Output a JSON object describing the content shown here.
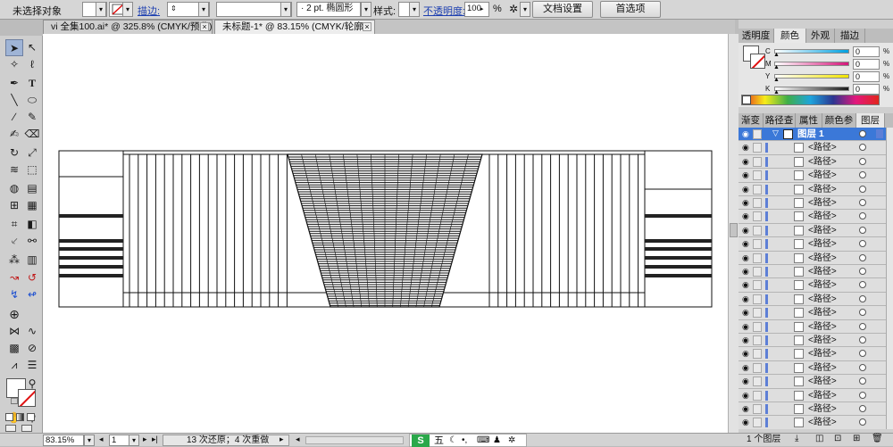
{
  "control_bar": {
    "selection_status": "未选择对象",
    "stroke_label": "描边:",
    "brush_value": "2 pt. 椭圆形",
    "style_label": "样式:",
    "opacity_label": "不透明度:",
    "opacity_value": "100",
    "opacity_unit": "%",
    "doc_setup_button": "文档设置",
    "preferences_button": "首选项"
  },
  "doc_tabs": [
    {
      "label": "vi 全集100.ai* @ 325.8% (CMYK/预览)",
      "active": false
    },
    {
      "label": "未标题-1* @ 83.15% (CMYK/轮廓)",
      "active": true
    }
  ],
  "close_glyph": "×",
  "color_panel": {
    "tabs": [
      "透明度",
      "颜色",
      "外观",
      "描边"
    ],
    "active_tab": "颜色",
    "channels": [
      {
        "label": "C",
        "value": "0",
        "unit": "%",
        "color": "#00a0e0"
      },
      {
        "label": "M",
        "value": "0",
        "unit": "%",
        "color": "#d4157a"
      },
      {
        "label": "Y",
        "value": "0",
        "unit": "%",
        "color": "#f2e400"
      },
      {
        "label": "K",
        "value": "0",
        "unit": "%",
        "color": "#1a1a1a"
      }
    ]
  },
  "layers_panel": {
    "tabs": [
      "渐变",
      "路径查",
      "属性",
      "颜色参",
      "图层"
    ],
    "active_tab": "图层",
    "layer_name": "图层 1",
    "item_label": "<路径>",
    "item_count": 21,
    "footer_label": "1 个图层"
  },
  "status_bar": {
    "zoom": "83.15%",
    "page": "1",
    "status_text": "13 次还原；4 次重做"
  },
  "ime_bar": {
    "logo": "S",
    "mode": "五"
  },
  "colors": {
    "accent_selection": "#3b78d8",
    "layer_color": "#5d7fd6",
    "panel_bg": "#cfcfcf"
  },
  "icons": [
    "selection-tool-icon",
    "direct-selection-icon",
    "magic-wand-icon",
    "lasso-icon",
    "pen-icon",
    "type-icon",
    "line-icon",
    "ellipse-icon",
    "brush-icon",
    "pencil-icon",
    "eraser-icon",
    "rotate-icon",
    "scale-icon",
    "warp-icon",
    "free-transform-icon",
    "shape-builder-icon",
    "perspective-icon",
    "mesh-icon",
    "gradient-icon",
    "eyedropper-icon",
    "blend-icon",
    "symbol-sprayer-icon",
    "column-graph-icon",
    "artboard-icon",
    "slice-icon",
    "hand-icon",
    "zoom-icon",
    "fill-swatch-icon",
    "stroke-swatch-icon",
    "eye-icon",
    "target-icon"
  ]
}
